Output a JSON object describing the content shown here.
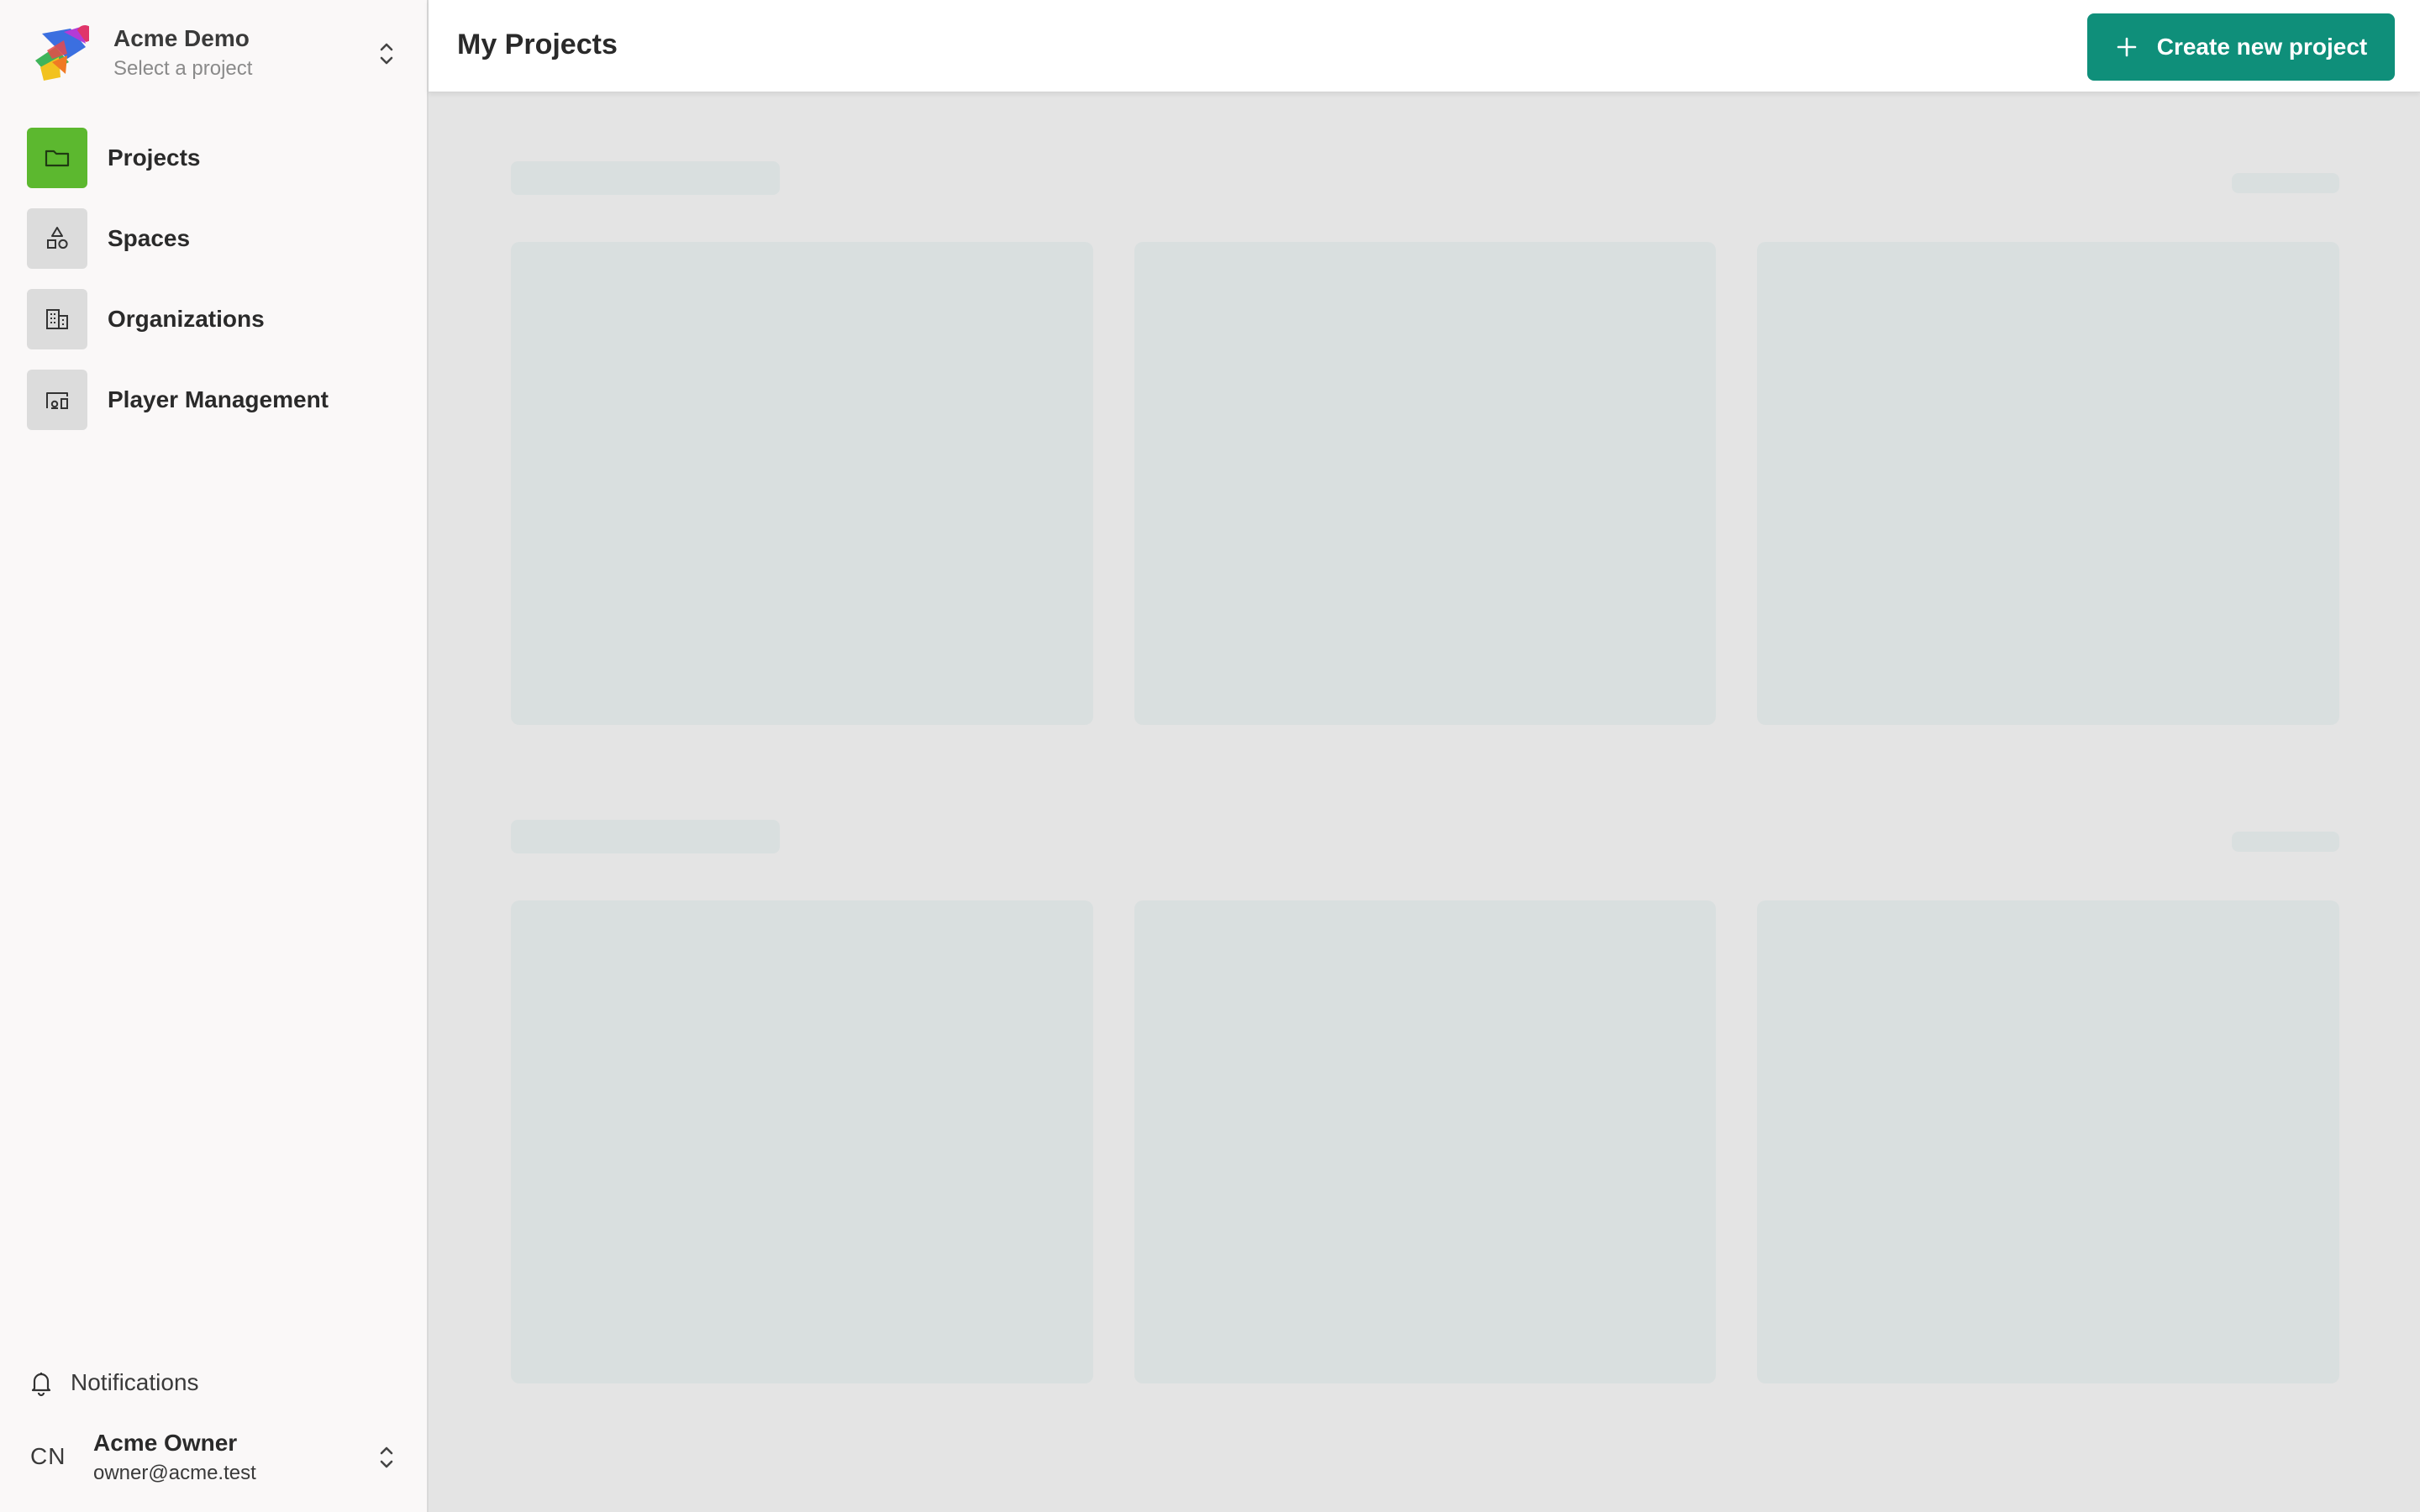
{
  "workspace": {
    "name": "Acme Demo",
    "subtitle": "Select a project"
  },
  "sidebar": {
    "items": [
      {
        "label": "Projects",
        "icon": "folder-icon",
        "active": true
      },
      {
        "label": "Spaces",
        "icon": "shapes-icon",
        "active": false
      },
      {
        "label": "Organizations",
        "icon": "building-icon",
        "active": false
      },
      {
        "label": "Player Management",
        "icon": "display-devices-icon",
        "active": false
      }
    ],
    "notifications_label": "Notifications"
  },
  "user": {
    "initials": "CN",
    "name": "Acme Owner",
    "email": "owner@acme.test"
  },
  "header": {
    "title": "My Projects",
    "create_button_label": "Create new project"
  },
  "colors": {
    "accent": "#0f8f7a",
    "active_nav": "#5cb82f",
    "skeleton": "#d9dfdf",
    "content_background": "#e4e4e4"
  }
}
